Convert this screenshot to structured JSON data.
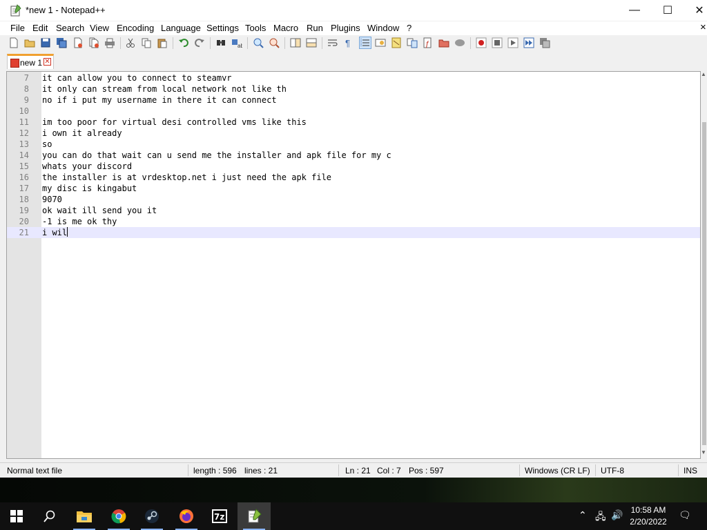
{
  "window": {
    "title": "*new 1 - Notepad++",
    "controls": {
      "minimize": "—",
      "maximize": "☐",
      "close": "✕"
    }
  },
  "menu": {
    "items": [
      "File",
      "Edit",
      "Search",
      "View",
      "Encoding",
      "Language",
      "Settings",
      "Tools",
      "Macro",
      "Run",
      "Plugins",
      "Window",
      "?"
    ],
    "overflow_close": "×"
  },
  "toolbar": {
    "buttons": [
      "new-file-icon",
      "open-file-icon",
      "save-icon",
      "save-all-icon",
      "close-icon",
      "close-all-icon",
      "print-icon",
      "cut-icon",
      "copy-icon",
      "paste-icon",
      "undo-icon",
      "redo-icon",
      "find-icon",
      "replace-icon",
      "zoom-in-icon",
      "zoom-out-icon",
      "sync-vertical-icon",
      "sync-horizontal-icon",
      "word-wrap-icon",
      "show-all-chars-icon",
      "indent-guide-icon",
      "user-language-icon",
      "document-map-icon",
      "function-list-icon",
      "folder-workspace-icon",
      "monitoring-icon",
      "record-macro-icon",
      "stop-macro-icon",
      "play-macro-icon",
      "play-multiple-icon",
      "save-macro-icon"
    ]
  },
  "tabs": [
    {
      "label": "new 1",
      "close": "✕"
    }
  ],
  "editor": {
    "lines": [
      {
        "n": "7",
        "text": "it can allow you to connect to steamvr"
      },
      {
        "n": "8",
        "text": "it only can stream from local network not like th"
      },
      {
        "n": "9",
        "text": "no if i put my username in there it can connect"
      },
      {
        "n": "10",
        "text": ""
      },
      {
        "n": "11",
        "text": "im too poor for virtual desi controlled vms like this"
      },
      {
        "n": "12",
        "text": "i own it already"
      },
      {
        "n": "13",
        "text": "so"
      },
      {
        "n": "14",
        "text": "you can do that wait can u send me the installer and apk file for my c"
      },
      {
        "n": "15",
        "text": "whats your discord"
      },
      {
        "n": "16",
        "text": "the installer is at vrdesktop.net i just need the apk file"
      },
      {
        "n": "17",
        "text": "my disc is kingabut"
      },
      {
        "n": "18",
        "text": "9070"
      },
      {
        "n": "19",
        "text": "ok wait ill send you it"
      },
      {
        "n": "20",
        "text": "-1 is me ok thy"
      },
      {
        "n": "21",
        "text": "i wil"
      }
    ],
    "current_line_index": 14,
    "scroll_up": "▲",
    "scroll_down": "▼"
  },
  "status": {
    "file_type": "Normal text file",
    "length": "length : 596",
    "lines": "lines : 21",
    "ln": "Ln : 21",
    "col": "Col : 7",
    "pos": "Pos : 597",
    "eol": "Windows (CR LF)",
    "encoding": "UTF-8",
    "mode": "INS"
  },
  "taskbar": {
    "apps": [
      "windows-start",
      "search",
      "file-explorer",
      "chrome",
      "steam",
      "firefox",
      "7zip",
      "notepadpp"
    ],
    "tray": {
      "chevron": "⌃",
      "network": "🖧",
      "volume": "🔊",
      "time": "10:58 AM",
      "date": "2/20/2022",
      "notification": "🗨"
    }
  },
  "colors": {
    "tab_accent": "#f0a030",
    "current_line": "#e8e8ff",
    "gutter": "#e4e4e4",
    "taskbar": "#101010"
  }
}
